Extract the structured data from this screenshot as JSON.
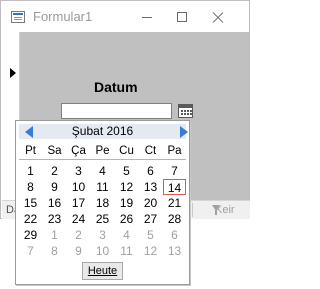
{
  "window": {
    "title": "Formular1",
    "datum_label": "Datum",
    "navigation_label": "Da",
    "filter_label": "Keir"
  },
  "calendar": {
    "month_label": "Şubat 2016",
    "weekdays": [
      "Pt",
      "Sa",
      "Ça",
      "Pe",
      "Cu",
      "Ct",
      "Pa"
    ],
    "weeks": [
      [
        {
          "d": "1",
          "o": false
        },
        {
          "d": "2",
          "o": false
        },
        {
          "d": "3",
          "o": false
        },
        {
          "d": "4",
          "o": false
        },
        {
          "d": "5",
          "o": false
        },
        {
          "d": "6",
          "o": false
        },
        {
          "d": "7",
          "o": false
        }
      ],
      [
        {
          "d": "8",
          "o": false
        },
        {
          "d": "9",
          "o": false
        },
        {
          "d": "10",
          "o": false
        },
        {
          "d": "11",
          "o": false
        },
        {
          "d": "12",
          "o": false
        },
        {
          "d": "13",
          "o": false
        },
        {
          "d": "14",
          "o": false
        }
      ],
      [
        {
          "d": "15",
          "o": false
        },
        {
          "d": "16",
          "o": false
        },
        {
          "d": "17",
          "o": false
        },
        {
          "d": "18",
          "o": false
        },
        {
          "d": "19",
          "o": false
        },
        {
          "d": "20",
          "o": false
        },
        {
          "d": "21",
          "o": false
        }
      ],
      [
        {
          "d": "22",
          "o": false
        },
        {
          "d": "23",
          "o": false
        },
        {
          "d": "24",
          "o": false
        },
        {
          "d": "25",
          "o": false
        },
        {
          "d": "26",
          "o": false
        },
        {
          "d": "27",
          "o": false
        },
        {
          "d": "28",
          "o": false
        }
      ],
      [
        {
          "d": "29",
          "o": false
        },
        {
          "d": "1",
          "o": true
        },
        {
          "d": "2",
          "o": true
        },
        {
          "d": "3",
          "o": true
        },
        {
          "d": "4",
          "o": true
        },
        {
          "d": "5",
          "o": true
        },
        {
          "d": "6",
          "o": true
        }
      ],
      [
        {
          "d": "7",
          "o": true
        },
        {
          "d": "8",
          "o": true
        },
        {
          "d": "9",
          "o": true
        },
        {
          "d": "10",
          "o": true
        },
        {
          "d": "11",
          "o": true
        },
        {
          "d": "12",
          "o": true
        },
        {
          "d": "13",
          "o": true
        }
      ]
    ],
    "today": "14",
    "today_button": "Heute",
    "accent_color": "#3a7bd5",
    "today_marker_color": "#e0584a",
    "header_background": "#e5e9f1"
  }
}
